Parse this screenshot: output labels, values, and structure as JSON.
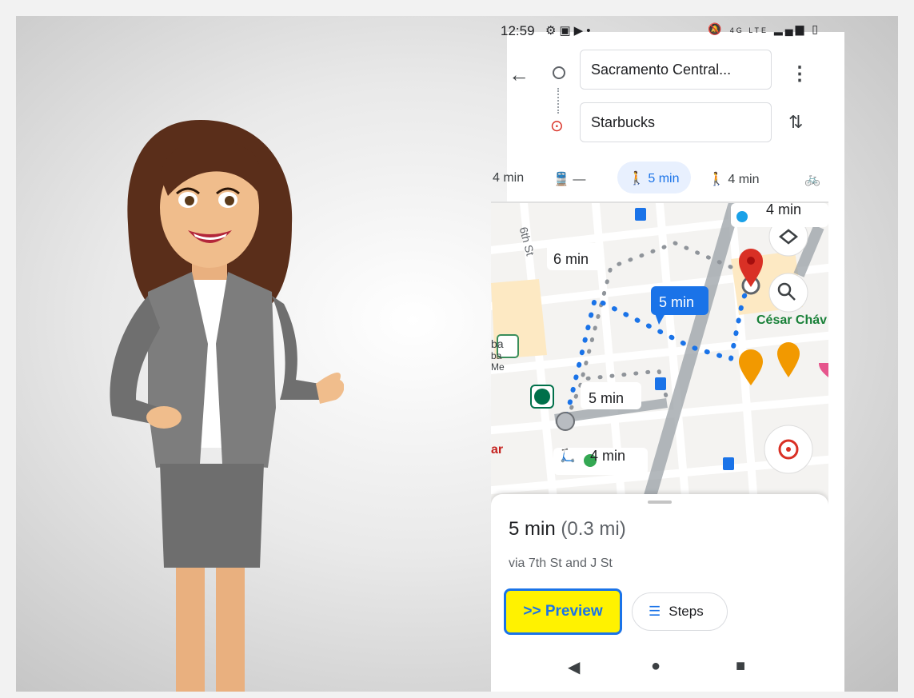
{
  "status_bar": {
    "time": "12:59",
    "left_icons": [
      "gear-icon",
      "gmail-icon",
      "youtube-icon",
      "dot-icon"
    ],
    "right_icons": [
      "mute-icon",
      "lte-icon",
      "signal-icon",
      "battery-icon"
    ],
    "network": "4G LTE"
  },
  "directions": {
    "origin": "Sacramento Central...",
    "destination": "Starbucks"
  },
  "modes": [
    {
      "label": "4 min",
      "icon": "car-icon"
    },
    {
      "label": "—",
      "icon": "transit-icon"
    },
    {
      "label": "5 min",
      "icon": "walk-icon",
      "active": true
    },
    {
      "label": "4 min",
      "icon": "ride-icon"
    },
    {
      "label": "",
      "icon": "bike-icon"
    }
  ],
  "map": {
    "street_label": "6th St",
    "poi_label": "César Cháv",
    "partial_labels": [
      "ba",
      "ba",
      "Me",
      "ar"
    ],
    "route_bubbles": [
      {
        "label": "6 min"
      },
      {
        "label": "5 min",
        "selected": true
      },
      {
        "label": "5 min"
      },
      {
        "label": "4 min",
        "icon": "scooter-icon"
      },
      {
        "label": "4 min",
        "icon": "scooter-icon"
      }
    ],
    "colors": {
      "route": "#1a73e8",
      "road": "#8f949a",
      "pin": "#d93025",
      "coffee": "#f29900"
    }
  },
  "route_summary": {
    "duration": "5 min",
    "distance": "(0.3 mi)",
    "via": "via 7th St and J St"
  },
  "buttons": {
    "preview": ">> Preview",
    "steps": "Steps"
  },
  "colors": {
    "accent": "#1a73e8",
    "highlight": "#fff200",
    "pin": "#d93025"
  }
}
